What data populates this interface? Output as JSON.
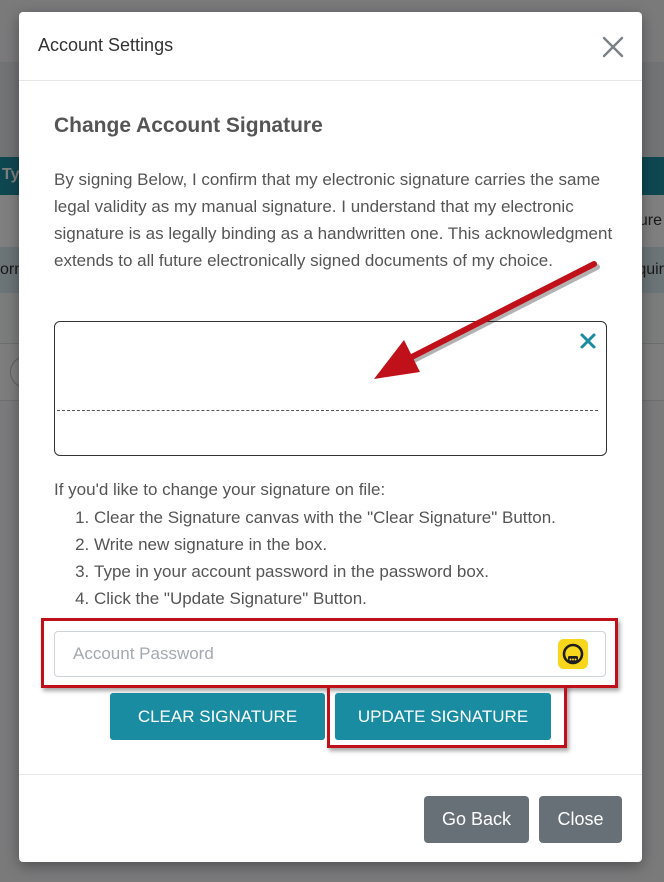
{
  "background": {
    "header_fragment": "Ty",
    "row1_right_fragment": "ure",
    "row2_left_fragment": "orm",
    "row2_right_fragment": "quir"
  },
  "modal": {
    "title": "Account Settings",
    "section_title": "Change Account Signature",
    "intro_text": "By signing Below, I confirm that my electronic signature carries the same legal validity as my manual signature. I understand that my electronic signature is as legally binding as a handwritten one. This acknowledgment extends to all future electronically signed documents of my choice.",
    "instructions_intro": "If you'd like to change your signature on file:",
    "steps": [
      "Clear the Signature canvas with the \"Clear Signature\" Button.",
      "Write new signature in the box.",
      "Type in your account password in the password box.",
      "Click the \"Update Signature\" Button."
    ],
    "password": {
      "placeholder": "Account Password",
      "value": "",
      "icon": "password-manager-icon"
    },
    "buttons": {
      "clear_signature": "CLEAR SIGNATURE",
      "update_signature": "UPDATE SIGNATURE",
      "go_back": "Go Back",
      "close": "Close"
    }
  },
  "colors": {
    "accent_teal": "#1a8ca2",
    "secondary_gray": "#687077",
    "annotation_red": "#c0101a",
    "password_icon_yellow": "#f7d61c"
  }
}
